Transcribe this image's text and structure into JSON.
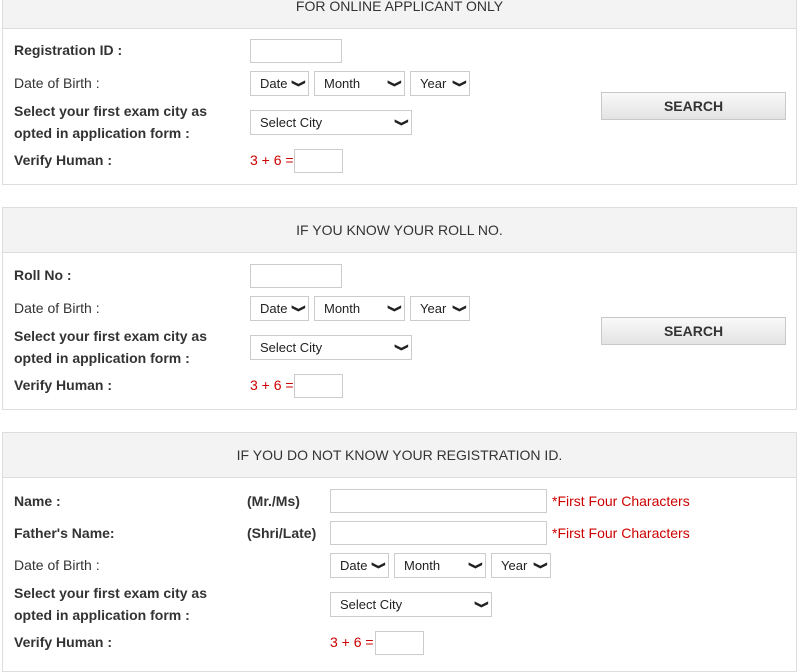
{
  "panel1": {
    "heading": "FOR ONLINE APPLICANT ONLY",
    "registration_label": "Registration ID :",
    "registration_value": "",
    "dob_label": "Date of Birth :",
    "date_select": "Date",
    "month_select": "Month",
    "year_select": "Year",
    "city_label_line1": "Select your first exam city as",
    "city_label_line2": "opted in application form :",
    "city_select": "Select City",
    "verify_label": "Verify Human :",
    "captcha_question": "3 + 6 =",
    "captcha_value": "",
    "search_label": "SEARCH"
  },
  "panel2": {
    "heading": "IF YOU KNOW YOUR ROLL NO.",
    "roll_label": "Roll No :",
    "roll_value": "",
    "dob_label": "Date of Birth :",
    "date_select": "Date",
    "month_select": "Month",
    "year_select": "Year",
    "city_label_line1": "Select your first exam city as",
    "city_label_line2": "opted in application form :",
    "city_select": "Select City",
    "verify_label": "Verify Human :",
    "captcha_question": "3 + 6 =",
    "captcha_value": "",
    "search_label": "SEARCH"
  },
  "panel3": {
    "heading": "IF YOU DO NOT KNOW YOUR REGISTRATION ID.",
    "name_label": "Name :",
    "name_prefix": "(Mr./Ms)",
    "name_value": "",
    "name_hint": "*First Four Characters",
    "father_label": "Father's Name:",
    "father_prefix": "(Shri/Late)",
    "father_value": "",
    "father_hint": "*First Four Characters",
    "dob_label": "Date of Birth :",
    "date_select": "Date",
    "month_select": "Month",
    "year_select": "Year",
    "city_label_line1": "Select your first exam city as",
    "city_label_line2": "opted in application form :",
    "city_select": "Select City",
    "verify_label": "Verify Human :",
    "captcha_question": "3 + 6 =",
    "captcha_value": ""
  },
  "colors": {
    "header_bg": "#f3f3f3",
    "border": "#dddddd",
    "captcha_red": "#cc0000"
  }
}
